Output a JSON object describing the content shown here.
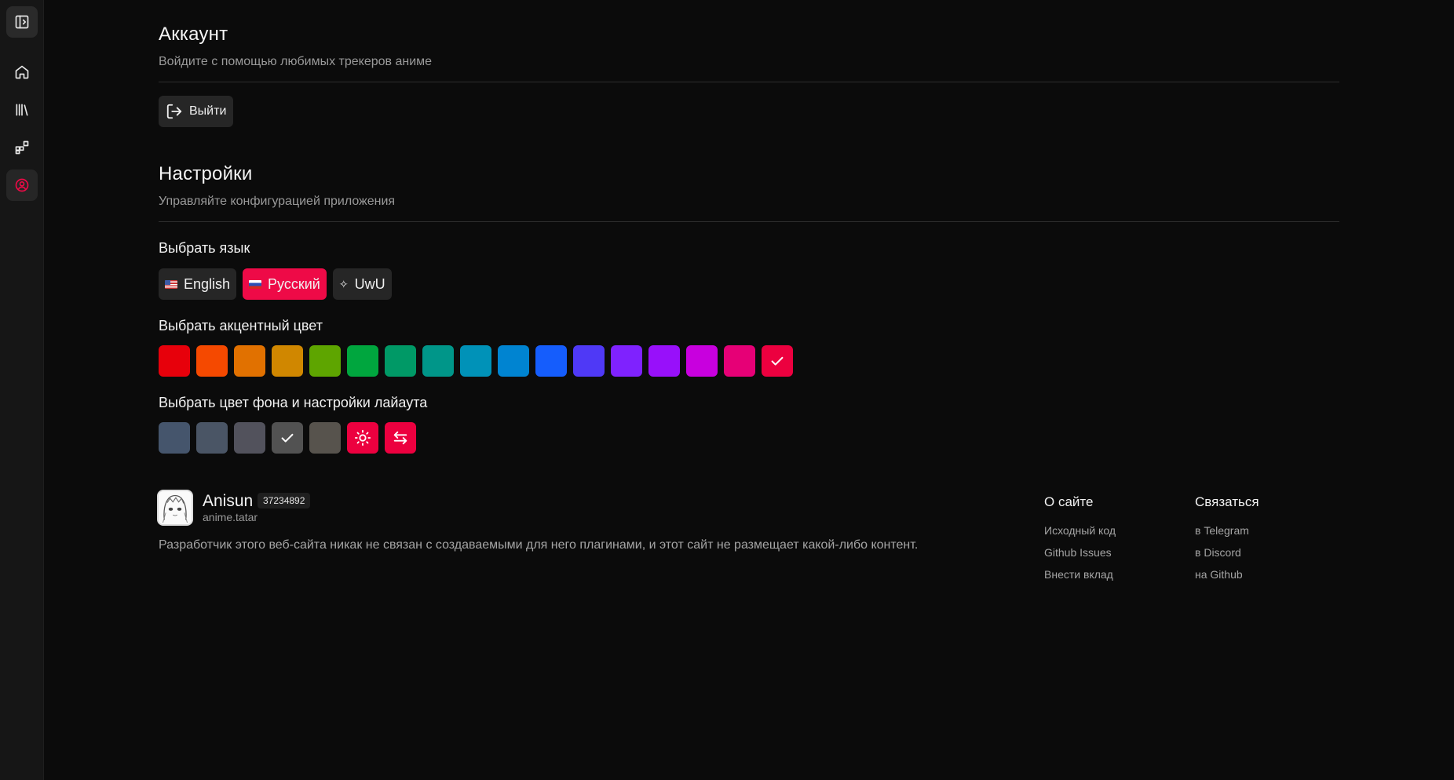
{
  "sidebar": {
    "items": [
      {
        "icon": "sidebar-toggle-icon"
      },
      {
        "icon": "home-icon"
      },
      {
        "icon": "library-icon"
      },
      {
        "icon": "extensions-icon"
      },
      {
        "icon": "user-circle-icon"
      }
    ],
    "active_color": "#ee0a47"
  },
  "account": {
    "title": "Аккаунт",
    "subtitle": "Войдите с помощью любимых трекеров аниме",
    "logout_label": "Выйти"
  },
  "settings": {
    "title": "Настройки",
    "subtitle": "Управляйте конфигурацией приложения",
    "language": {
      "label": "Выбрать язык",
      "options": [
        {
          "label": "English",
          "icon": "us-flag",
          "selected": false
        },
        {
          "label": "Русский",
          "icon": "ru-flag",
          "selected": true
        },
        {
          "label": "UwU",
          "icon": "sparkle-icon",
          "selected": false
        }
      ]
    },
    "accent": {
      "label": "Выбрать акцентный цвет",
      "colors": [
        "#e7000b",
        "#f54900",
        "#e17100",
        "#d08700",
        "#5ea500",
        "#00a63e",
        "#009966",
        "#009689",
        "#0092b8",
        "#0084d1",
        "#155dfc",
        "#4f39f6",
        "#7f22fe",
        "#9810fa",
        "#c800de",
        "#e60076",
        "#ec003f"
      ],
      "selected_index": 16
    },
    "background": {
      "label": "Выбрать цвет фона и настройки лайаута",
      "colors": [
        "#45556c",
        "#4a5565",
        "#52525c",
        "#525252",
        "#57534d"
      ],
      "selected_index": 3,
      "toggle_buttons": [
        {
          "icon": "sun-icon",
          "color": "#ec003f"
        },
        {
          "icon": "swap-arrows-icon",
          "color": "#ec003f"
        }
      ]
    }
  },
  "footer": {
    "brand": "Anisun",
    "badge": "37234892",
    "domain": "anime.tatar",
    "disclaimer": "Разработчик этого веб-сайта никак не связан с создаваемыми для него плагинами, и этот сайт не размещает какой-либо контент.",
    "columns": [
      {
        "title": "О сайте",
        "links": [
          "Исходный код",
          "Github Issues",
          "Внести вклад"
        ]
      },
      {
        "title": "Связаться",
        "links": [
          "в Telegram",
          "в Discord",
          "на Github"
        ]
      }
    ]
  }
}
